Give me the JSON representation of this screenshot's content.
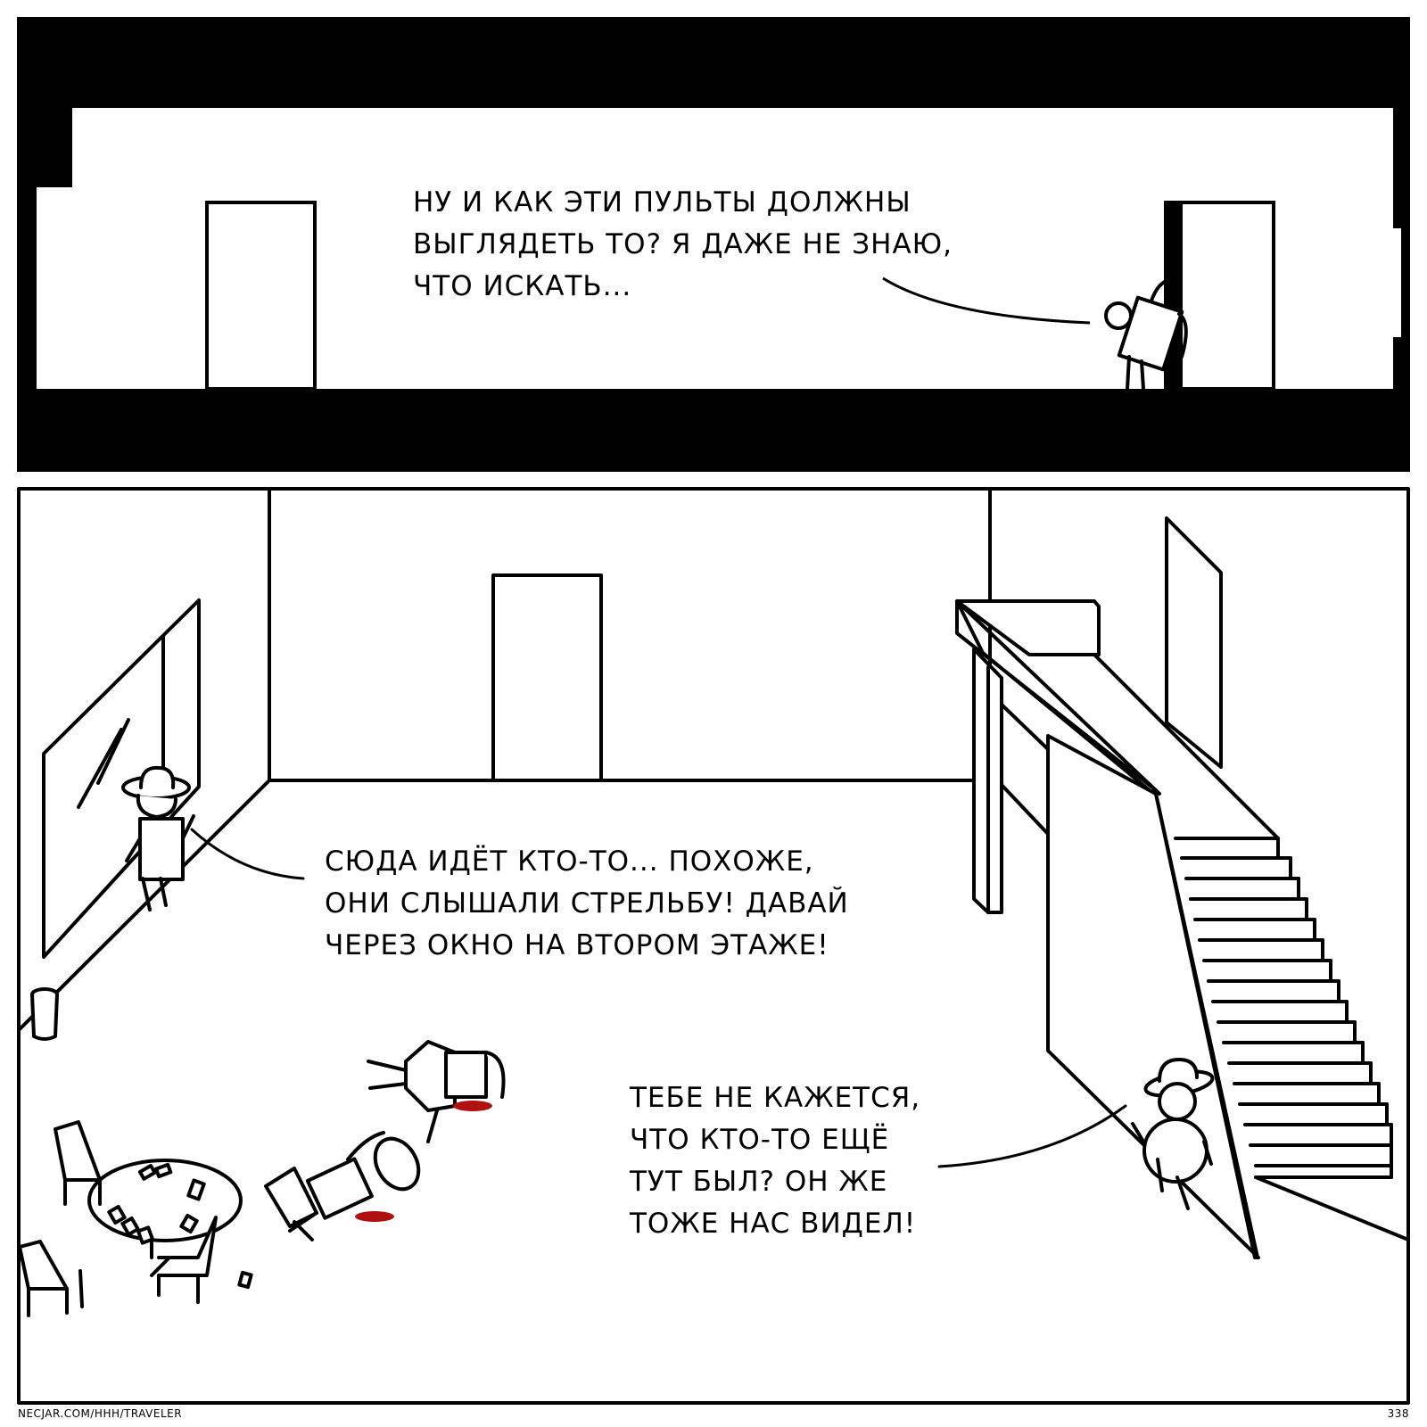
{
  "comic": {
    "panel_1": {
      "speech": {
        "lines": [
          "НУ И КАК ЭТИ ПУЛЬТЫ ДОЛЖНЫ",
          "ВЫГЛЯДЕТЬ ТО? Я ДАЖЕ НЕ ЗНАЮ,",
          "ЧТО ИСКАТЬ..."
        ]
      }
    },
    "panel_2": {
      "speech_left": {
        "lines": [
          "СЮДА ИДЁТ КТО-ТО... ПОХОЖЕ,",
          "ОНИ СЛЫШАЛИ СТРЕЛЬБУ! ДАВАЙ",
          "ЧЕРЕЗ ОКНО НА ВТОРОМ ЭТАЖЕ!"
        ]
      },
      "speech_right": {
        "lines": [
          "ТЕБЕ НЕ КАЖЕТСЯ,",
          "ЧТО КТО-ТО ЕЩЁ",
          "ТУТ БЫЛ? ОН ЖЕ",
          "ТОЖЕ НАС ВИДЕЛ!"
        ]
      }
    },
    "footer": {
      "url": "NECJAR.COM/HHH/TRAVELER",
      "page_number": "338"
    },
    "colors": {
      "ink": "#000000",
      "paper": "#ffffff",
      "blood": "#b01010"
    }
  }
}
